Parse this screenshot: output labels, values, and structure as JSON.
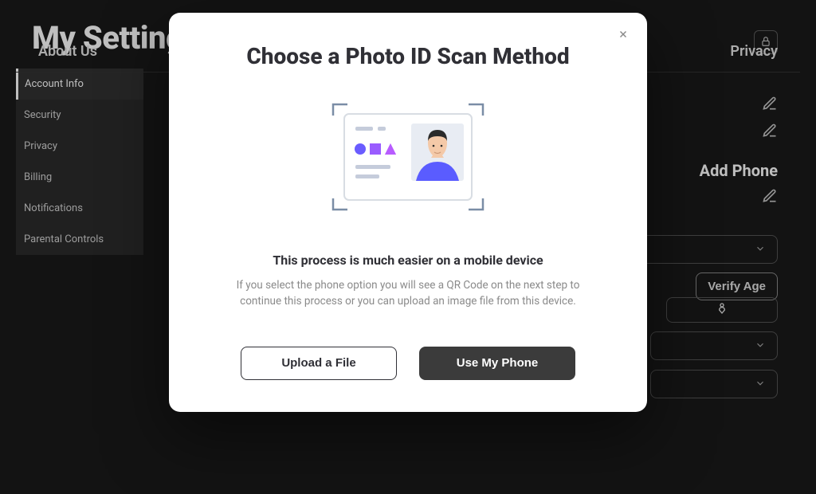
{
  "header": {
    "title": "My Settings"
  },
  "sidebar": {
    "items": [
      {
        "label": "Account Info",
        "active": true
      },
      {
        "label": "Security",
        "active": false
      },
      {
        "label": "Privacy",
        "active": false
      },
      {
        "label": "Billing",
        "active": false
      },
      {
        "label": "Notifications",
        "active": false
      },
      {
        "label": "Parental Controls",
        "active": false
      }
    ]
  },
  "right_panel": {
    "add_phone": "Add Phone",
    "verify_age": "Verify Age"
  },
  "footer": {
    "about": "About Us",
    "privacy": "Privacy"
  },
  "modal": {
    "title": "Choose a Photo ID Scan Method",
    "subtitle": "This process is much easier on a mobile device",
    "body": "If you select the phone option you will see a QR Code on the next step to continue this process or you can upload an image file from this device.",
    "upload_label": "Upload a File",
    "phone_label": "Use My Phone"
  }
}
